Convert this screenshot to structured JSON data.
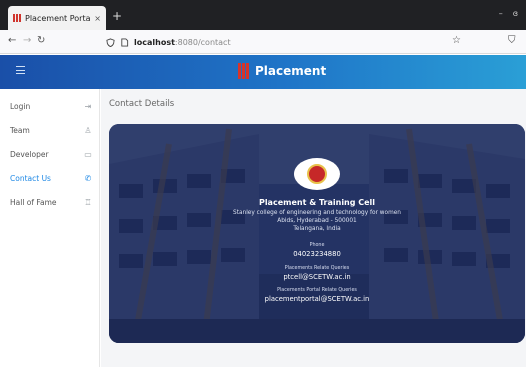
{
  "browser": {
    "tab_title": "Placement Portal : Stanl",
    "tab_close": "×",
    "new_tab": "+",
    "win_min": "–",
    "win_close": "ɞ",
    "url_host": "localhost",
    "url_path": ":8080/contact"
  },
  "header": {
    "brand": "Placement"
  },
  "sidebar": {
    "items": [
      {
        "label": "Login",
        "icon": "login-icon"
      },
      {
        "label": "Team",
        "icon": "team-icon"
      },
      {
        "label": "Developer",
        "icon": "developer-icon"
      },
      {
        "label": "Contact Us",
        "icon": "phone-icon"
      },
      {
        "label": "Hall of Fame",
        "icon": "trophy-icon"
      }
    ]
  },
  "main": {
    "title": "Contact Details"
  },
  "contact": {
    "cell_title": "Placement & Training Cell",
    "address_line1": "Stanley college of engineering and technology for women",
    "address_line2": "Abids, Hyderabad - 500001",
    "address_line3": "Telangana, India",
    "phone_label": "Phone",
    "phone_value": "04023234880",
    "placements_label": "Placements Relate Queries",
    "placements_email": "ptcell@SCETW.ac.in",
    "portal_label": "Placements Portal Relate Queries",
    "portal_email": "placementportal@SCETW.ac.in"
  },
  "colors": {
    "accent": "#1e88e5",
    "header_start": "#1a4fa8",
    "header_end": "#2a9fd6",
    "card_overlay": "#122052"
  }
}
